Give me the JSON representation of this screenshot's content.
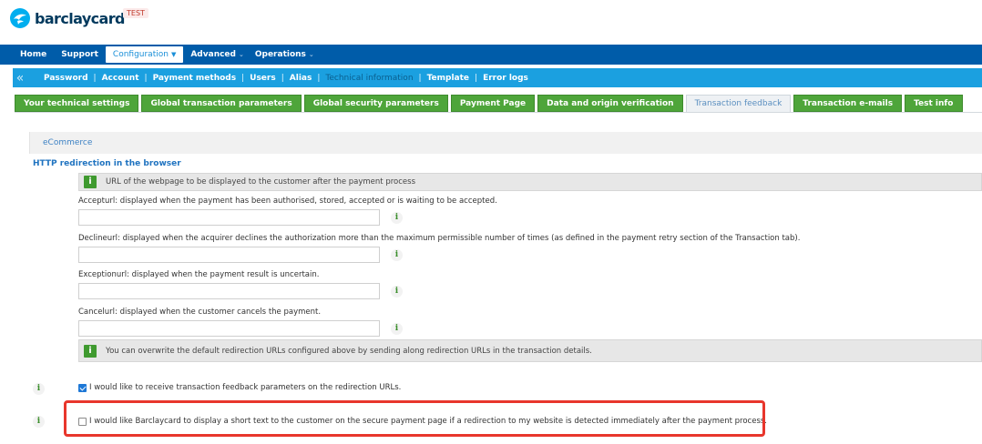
{
  "brand": {
    "name": "barclaycard",
    "env_badge": "TEST"
  },
  "main_nav": [
    {
      "label": "Home",
      "dropdown": false,
      "active": false
    },
    {
      "label": "Support",
      "dropdown": false,
      "active": false
    },
    {
      "label": "Configuration",
      "dropdown": true,
      "active": true
    },
    {
      "label": "Advanced",
      "dropdown": true,
      "active": false
    },
    {
      "label": "Operations",
      "dropdown": true,
      "active": false
    }
  ],
  "sub_nav": [
    {
      "label": "Password",
      "current": false
    },
    {
      "label": "Account",
      "current": false
    },
    {
      "label": "Payment methods",
      "current": false
    },
    {
      "label": "Users",
      "current": false
    },
    {
      "label": "Alias",
      "current": false
    },
    {
      "label": "Technical information",
      "current": true
    },
    {
      "label": "Template",
      "current": false
    },
    {
      "label": "Error logs",
      "current": false
    }
  ],
  "tabs": [
    {
      "label": "Your technical settings",
      "active": false
    },
    {
      "label": "Global transaction parameters",
      "active": false
    },
    {
      "label": "Global security parameters",
      "active": false
    },
    {
      "label": "Payment Page",
      "active": false
    },
    {
      "label": "Data and origin verification",
      "active": false
    },
    {
      "label": "Transaction feedback",
      "active": true
    },
    {
      "label": "Transaction e-mails",
      "active": false
    },
    {
      "label": "Test info",
      "active": false
    }
  ],
  "section": {
    "title": "eCommerce",
    "subheading": "HTTP redirection in the browser",
    "info_top": "URL of the webpage to be displayed to the customer after the payment process",
    "fields": [
      {
        "label": "Accepturl: displayed when the payment has been authorised, stored, accepted or is waiting to be accepted.",
        "value": ""
      },
      {
        "label": "Declineurl: displayed when the acquirer declines the authorization more than the maximum permissible number of times (as defined in the payment retry section of the Transaction tab).",
        "value": ""
      },
      {
        "label": "Exceptionurl: displayed when the payment result is uncertain.",
        "value": ""
      },
      {
        "label": "Cancelurl: displayed when the customer cancels the payment.",
        "value": ""
      }
    ],
    "info_bottom": "You can overwrite the default redirection URLs configured above by sending along redirection URLs in the transaction details.",
    "checkboxes": [
      {
        "label": "I would like to receive transaction feedback parameters on the redirection URLs.",
        "checked": true
      },
      {
        "label": "I would like Barclaycard to display a short text to the customer on the secure payment page if a redirection to my website is detected immediately after the payment process.",
        "checked": false
      }
    ]
  },
  "icons": {
    "info": "i"
  },
  "colors": {
    "primary_nav": "#005ca9",
    "sub_nav": "#1ba0e0",
    "tab_green": "#4ea53a",
    "highlight": "#e8362c"
  }
}
